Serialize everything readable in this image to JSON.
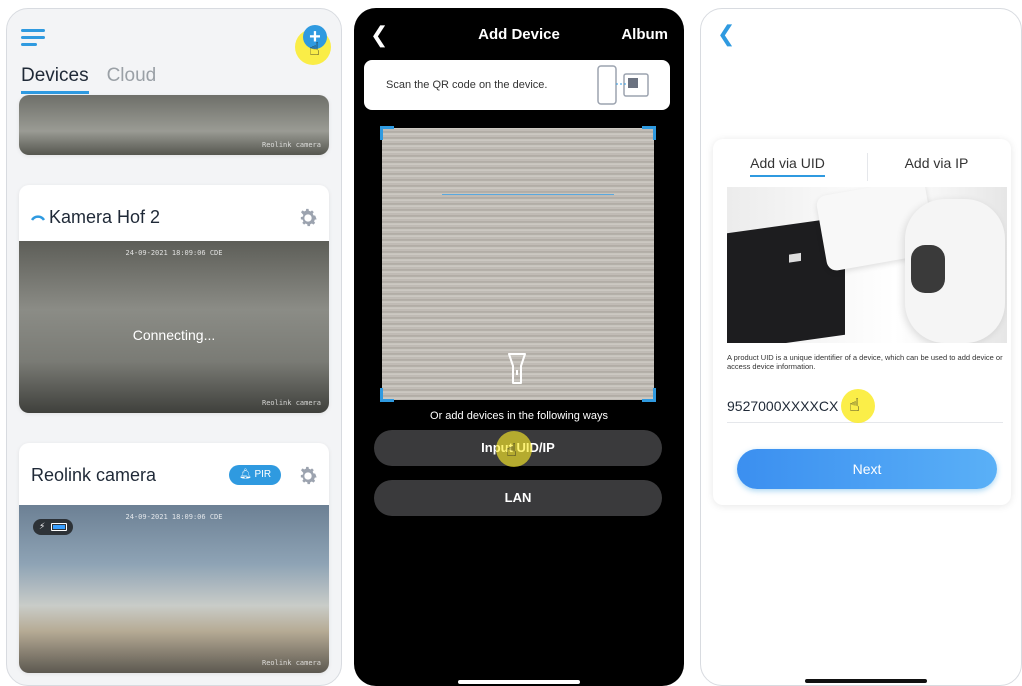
{
  "screen1": {
    "tabs": [
      {
        "label": "Devices",
        "active": true
      },
      {
        "label": "Cloud",
        "active": false
      }
    ],
    "cards": [
      {
        "watermark": "Reolink camera"
      },
      {
        "title": "Kamera Hof 2",
        "timestamp": "24-09-2021 18:09:06 CDE",
        "status": "Connecting...",
        "watermark": "Reolink camera"
      },
      {
        "title": "Reolink camera",
        "badge": "PIR",
        "timestamp": "24-09-2021 18:09:06 CDE",
        "watermark": "Reolink camera"
      }
    ],
    "icons": {
      "menu": "hamburger-icon",
      "add": "plus-circle-icon",
      "settings": "gear-icon",
      "wifi": "wifi-icon",
      "bell": "bell-icon",
      "battery": "battery-icon"
    },
    "accent": "#2f9ae0"
  },
  "screen2": {
    "title": "Add Device",
    "album": "Album",
    "qr_hint": "Scan the QR code on the device.",
    "alt_heading": "Or add devices in the following ways",
    "buttons": [
      "Input UID/IP",
      "LAN"
    ],
    "icons": {
      "back": "chevron-left-icon",
      "torch": "flashlight-icon",
      "qr": "qr-code-icon"
    }
  },
  "screen3": {
    "tabs": [
      {
        "label": "Add via UID",
        "active": true
      },
      {
        "label": "Add via IP",
        "active": false
      }
    ],
    "description": "A product UID is a unique identifier of a device, which can be used to add device or access device information.",
    "uid_value": "9527000XXXXCX",
    "next_label": "Next",
    "icons": {
      "back": "chevron-left-icon"
    }
  }
}
